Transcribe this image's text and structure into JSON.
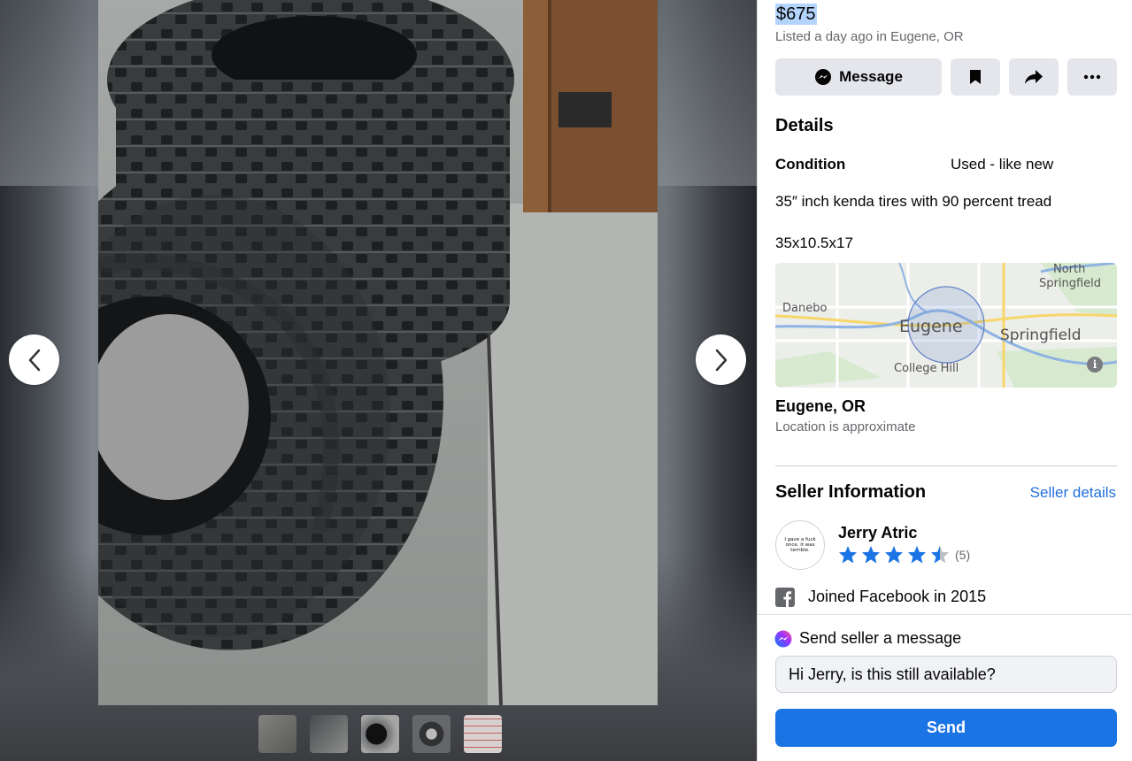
{
  "listing": {
    "price": "$675",
    "listed": "Listed a day ago in Eugene, OR"
  },
  "actions": {
    "message_label": "Message",
    "save_icon": "bookmark-icon",
    "share_icon": "share-icon",
    "more_icon": "more-icon"
  },
  "details": {
    "heading": "Details",
    "condition_label": "Condition",
    "condition_value": "Used - like new",
    "description": [
      "35″ inch kenda tires with 90 percent tread",
      "35x10.5x17"
    ]
  },
  "map": {
    "labels": {
      "north_springfield_1": "North",
      "north_springfield_2": "Springfield",
      "danebo": "Danebo",
      "eugene": "Eugene",
      "springfield": "Springfield",
      "college_hill": "College Hill"
    },
    "info_icon": "info-icon"
  },
  "location": {
    "title": "Eugene, OR",
    "subtitle": "Location is approximate"
  },
  "seller": {
    "heading": "Seller Information",
    "details_link": "Seller details",
    "avatar_text": "I gave a fuck once, it was terrible.",
    "name": "Jerry Atric",
    "rating_stars": 4.5,
    "rating_count": "(5)",
    "joined": "Joined Facebook in 2015"
  },
  "send_message": {
    "title": "Send seller a message",
    "input_value": "Hi Jerry, is this still available?",
    "send_label": "Send"
  },
  "colors": {
    "accent": "#1b74e4",
    "link": "#216fdb",
    "star": "#1b74e4",
    "button_bg": "#e4e6eb"
  }
}
